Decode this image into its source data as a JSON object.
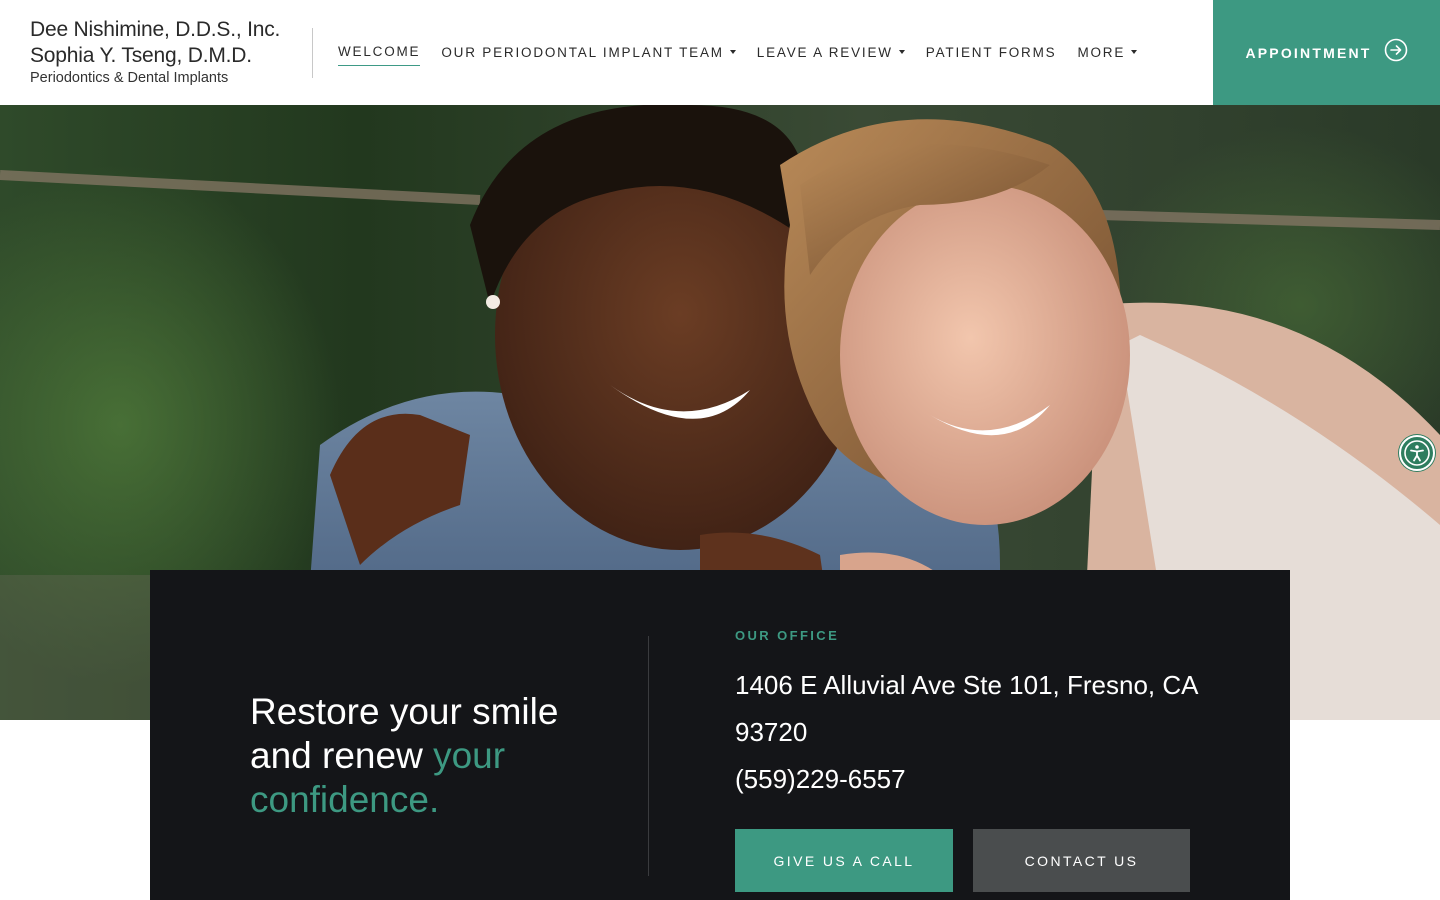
{
  "brand": {
    "line1": "Dee Nishimine, D.D.S., Inc.",
    "line2": "Sophia Y. Tseng, D.M.D.",
    "line3": "Periodontics & Dental Implants"
  },
  "nav": {
    "items": [
      {
        "label": "WELCOME",
        "active": true,
        "dropdown": false
      },
      {
        "label": "OUR PERIODONTAL IMPLANT TEAM",
        "active": false,
        "dropdown": true
      },
      {
        "label": "LEAVE A REVIEW",
        "active": false,
        "dropdown": true
      },
      {
        "label": "PATIENT FORMS",
        "active": false,
        "dropdown": false
      },
      {
        "label": "MORE",
        "active": false,
        "dropdown": true
      }
    ],
    "appointment_label": "APPOINTMENT"
  },
  "hero": {
    "tagline_part1": "Restore your smile and renew",
    "tagline_accent": "your confidence."
  },
  "office": {
    "label": "OUR OFFICE",
    "address": "1406 E Alluvial Ave Ste 101, Fresno, CA 93720",
    "phone": "(559)229-6557",
    "call_label": "GIVE US A CALL",
    "contact_label": "CONTACT US"
  },
  "colors": {
    "accent": "#3d9982",
    "panel": "#141518",
    "contact_button": "#4a4d4e",
    "accessibility": "#2e7d5f"
  },
  "icons": [
    "arrow-right-circle-icon",
    "accessibility-icon",
    "chevron-down-icon"
  ]
}
